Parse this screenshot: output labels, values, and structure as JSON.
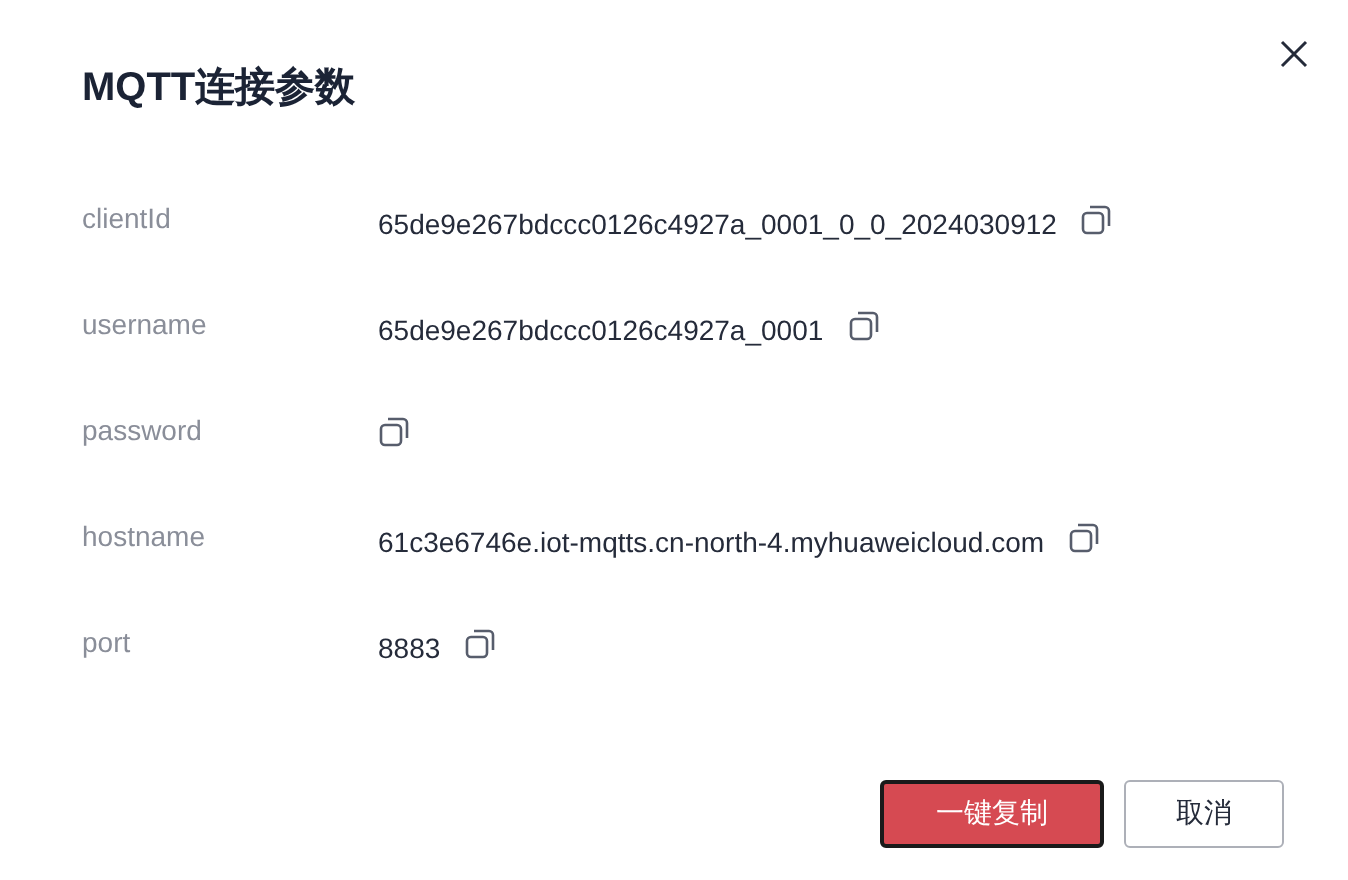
{
  "dialog": {
    "title": "MQTT连接参数"
  },
  "fields": [
    {
      "label": "clientId",
      "value": "65de9e267bdccc0126c4927a_0001_0_0_2024030912"
    },
    {
      "label": "username",
      "value": "65de9e267bdccc0126c4927a_0001"
    },
    {
      "label": "password"
    },
    {
      "label": "hostname",
      "value": "61c3e6746e.iot-mqtts.cn-north-4.myhuaweicloud.com"
    },
    {
      "label": "port",
      "value": "8883"
    }
  ],
  "buttons": [
    {
      "label": "一键复制",
      "kind": "primary"
    },
    {
      "label": "取消",
      "kind": "default"
    }
  ]
}
